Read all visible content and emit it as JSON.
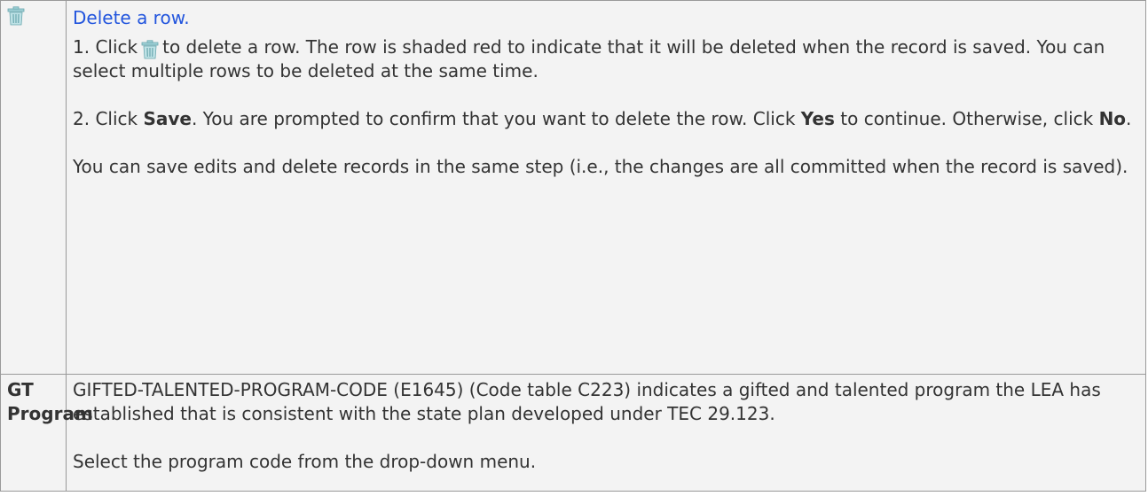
{
  "rows": [
    {
      "field_icon": "trash-icon",
      "title_link": "Delete a row.",
      "step1_before": "1. Click",
      "step1_icon": "trash-icon",
      "step1_after": "to delete a row. The row is shaded red to indicate that it will be deleted when the record is saved. You can select multiple rows to be deleted at the same time.",
      "step2_prefix": "2. Click ",
      "step2_save": "Save",
      "step2_mid": ". You are prompted to confirm that you want to delete the row. Click ",
      "step2_yes": "Yes",
      "step2_mid2": " to continue. Otherwise, click ",
      "step2_no": "No",
      "step2_end": ".",
      "note": "You can save edits and delete records in the same step (i.e., the changes are all committed when the record is saved)."
    },
    {
      "field_name": "GT Program",
      "desc": "GIFTED-TALENTED-PROGRAM-CODE (E1645) (Code table C223) indicates a gifted and talented program the LEA has established that is consistent with the state plan developed under TEC 29.123.",
      "note": "Select the program code from the drop-down menu."
    }
  ],
  "colors": {
    "cell_bg": "#f3f3f3",
    "border": "#999999",
    "link": "#2255dd",
    "text": "#333333",
    "icon": "#8fc3c9"
  }
}
